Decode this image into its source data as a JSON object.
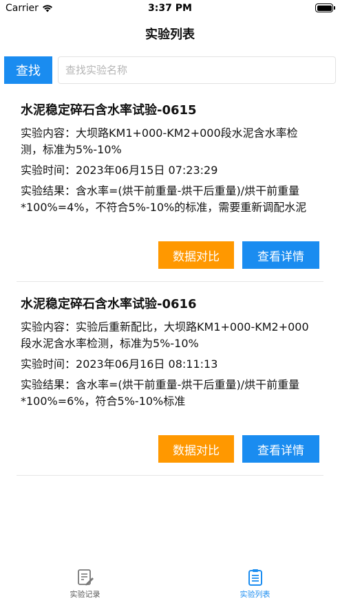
{
  "status_bar": {
    "carrier": "Carrier",
    "time": "3:37 PM"
  },
  "nav": {
    "title": "实验列表"
  },
  "search": {
    "button_label": "查找",
    "placeholder": "查找实验名称"
  },
  "experiments": [
    {
      "title": "水泥稳定碎石含水率试验-0615",
      "content_label": "实验内容：",
      "content": "大坝路KM1+000-KM2+000段水泥含水率检测，标准为5%-10%",
      "time_label": "实验时间：",
      "time": "2023年06月15日 07:23:29",
      "result_label": "实验结果：",
      "result": "含水率=(烘干前重量-烘干后重量)/烘干前重量*100%=4%，不符合5%-10%的标准，需要重新调配水泥",
      "compare_label": "数据对比",
      "detail_label": "查看详情"
    },
    {
      "title": "水泥稳定碎石含水率试验-0616",
      "content_label": "实验内容：",
      "content": "实验后重新配比，大坝路KM1+000-KM2+000段水泥含水率检测，标准为5%-10%",
      "time_label": "实验时间：",
      "time": "2023年06月16日 08:11:13",
      "result_label": "实验结果：",
      "result": "含水率=(烘干前重量-烘干后重量)/烘干前重量*100%=6%，符合5%-10%标准",
      "compare_label": "数据对比",
      "detail_label": "查看详情"
    }
  ],
  "tab_bar": {
    "tabs": [
      {
        "label": "实验记录",
        "icon": "edit-document-icon",
        "active": false
      },
      {
        "label": "实验列表",
        "icon": "clipboard-list-icon",
        "active": true
      }
    ]
  },
  "colors": {
    "primary": "#1a8cf0",
    "orange": "#ff9800",
    "divider": "#e6e6e6"
  }
}
